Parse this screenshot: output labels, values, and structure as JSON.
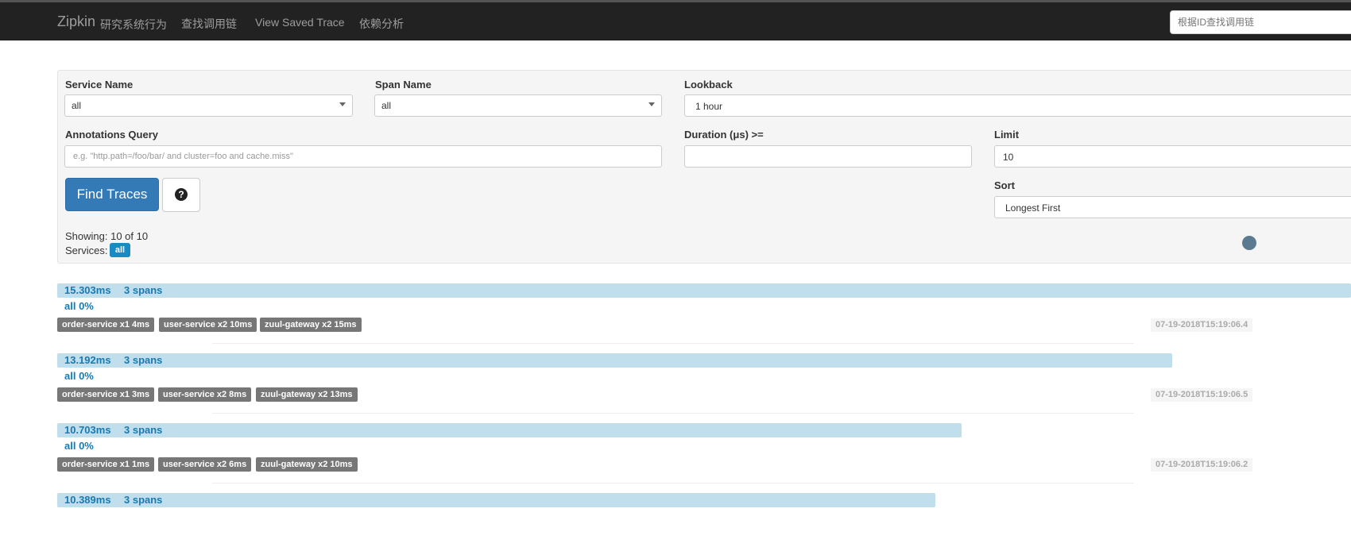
{
  "navbar": {
    "brand": "Zipkin",
    "brand_sub": "研究系统行为",
    "links": [
      "查找调用链",
      "View Saved Trace",
      "依赖分析"
    ],
    "search_placeholder": "根据ID查找调用链"
  },
  "form": {
    "service_name_label": "Service Name",
    "service_name_value": "all",
    "span_name_label": "Span Name",
    "span_name_value": "all",
    "lookback_label": "Lookback",
    "lookback_value": "1 hour",
    "annotations_label": "Annotations Query",
    "annotations_placeholder": "e.g. \"http.path=/foo/bar/ and cluster=foo and cache.miss\"",
    "duration_label": "Duration (μs) >=",
    "duration_value": "",
    "limit_label": "Limit",
    "limit_value": "10",
    "sort_label": "Sort",
    "sort_value": "Longest First",
    "find_button": "Find Traces",
    "help_icon": "question-circle-icon",
    "help_glyph": "?"
  },
  "results": {
    "showing": "Showing: 10 of 10",
    "services_label": "Services:",
    "services_badge": "all"
  },
  "traces": [
    {
      "duration": "15.303ms",
      "spans": "3 spans",
      "percent": "all 0%",
      "bar_fraction": 1.0,
      "tags": [
        "order-service x1 4ms",
        "user-service x2 10ms",
        "zuul-gateway x2 15ms"
      ],
      "timestamp": "07-19-2018T15:19:06.4"
    },
    {
      "duration": "13.192ms",
      "spans": "3 spans",
      "percent": "all 0%",
      "bar_fraction": 0.862,
      "tags": [
        "order-service x1 3ms",
        "user-service x2 8ms",
        "zuul-gateway x2 13ms"
      ],
      "timestamp": "07-19-2018T15:19:06.5"
    },
    {
      "duration": "10.703ms",
      "spans": "3 spans",
      "percent": "all 0%",
      "bar_fraction": 0.699,
      "tags": [
        "order-service x1 1ms",
        "user-service x2 6ms",
        "zuul-gateway x2 10ms"
      ],
      "timestamp": "07-19-2018T15:19:06.2"
    },
    {
      "duration": "10.389ms",
      "spans": "3 spans",
      "bar_fraction": 0.679
    }
  ],
  "colors": {
    "navbar_bg": "#222222",
    "primary": "#337ab7",
    "trace_bar": "#c0deec",
    "trace_text": "#1a7ab0",
    "tag_bg": "#777777",
    "badge": "#1a8ac4"
  }
}
